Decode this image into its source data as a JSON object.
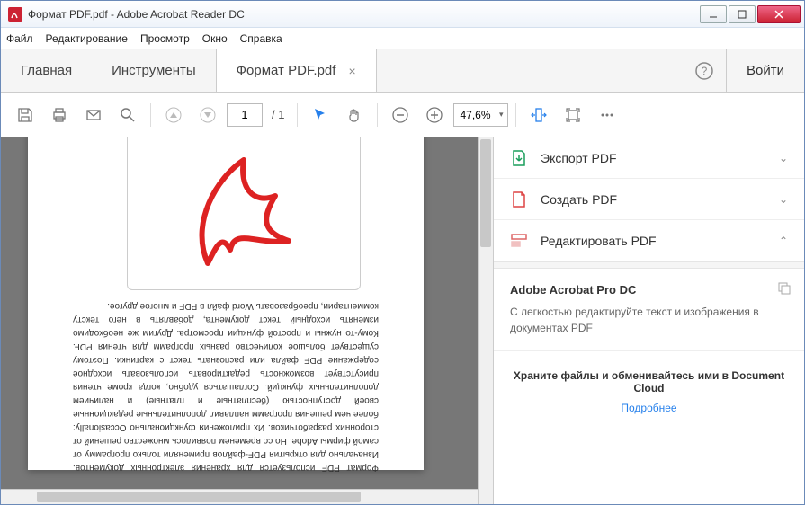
{
  "window": {
    "title": "Формат PDF.pdf - Adobe Acrobat Reader DC"
  },
  "menubar": {
    "file": "Файл",
    "edit": "Редактирование",
    "view": "Просмотр",
    "window": "Окно",
    "help": "Справка"
  },
  "tabs": {
    "home": "Главная",
    "tools": "Инструменты",
    "doc": "Формат PDF.pdf",
    "login": "Войти"
  },
  "toolbar": {
    "page_current": "1",
    "page_total": "/ 1",
    "zoom": "47,6%"
  },
  "rpanel": {
    "export": "Экспорт PDF",
    "create": "Создать PDF",
    "edit": "Редактировать PDF",
    "pro_title": "Adobe Acrobat Pro DC",
    "pro_desc": "С легкостью редактируйте текст и изображения в документах PDF",
    "cloud_title": "Храните файлы и обменивайтесь ими в Document Cloud",
    "cloud_link": "Подробнее"
  },
  "doc_text": "Формат PDF используется для хранения электронных документов. Изначально для открытия PDF-файлов применяли только программу от самой фирмы Adobe. Но со временем появилось множество решений от сторонних разработчиков. Их приложения функционально Occasionally: более чем решения программ наплавил дополнительные редакционные своей доступностью (бесплатные и платные) и наличием дополнительных функций. Соглашаться удобно, когда кроме чтения присутствует возможность редактировать использовать исходное содержание PDF файла или распознать текст с картинки. Поэтому существует большое количество разных программ для чтения PDF. Кому-то нужны и простой функции просмотра. Другим же необходимо изменять исходный текст документа, добавлять в него тексту комментарии, преобразовать Word файл в PDF и многое другое."
}
